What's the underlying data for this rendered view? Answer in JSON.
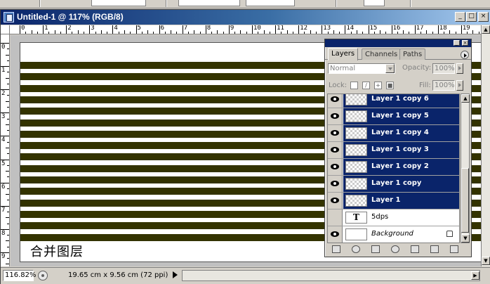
{
  "document": {
    "title": "Untitled-1 @ 117% (RGB/8)",
    "min_glyph": "_",
    "max_glyph": "□",
    "close_glyph": "×",
    "canvas_text": "合并图层",
    "stripe_color": "#333300"
  },
  "rulers": {
    "horizontal": [
      "0",
      "1",
      "2",
      "3",
      "4",
      "5",
      "6",
      "7",
      "8",
      "9",
      "10",
      "11",
      "12",
      "13",
      "14",
      "15",
      "16",
      "17",
      "18",
      "19"
    ],
    "vertical": [
      "0",
      "1",
      "2",
      "3",
      "4",
      "5",
      "6",
      "7",
      "8",
      "9"
    ]
  },
  "status": {
    "zoom": "116.82%",
    "doc_size": "19.65 cm x 9.56 cm (72 ppi)"
  },
  "layers_panel": {
    "tabs": [
      "Layers",
      "Channels",
      "Paths"
    ],
    "active_tab": "Layers",
    "blend_mode": "Normal",
    "opacity_label": "Opacity:",
    "opacity_value": "100%",
    "lock_label": "Lock:",
    "fill_label": "Fill:",
    "fill_value": "100%",
    "layers": [
      {
        "name": "Layer 1 copy 6",
        "selected": true,
        "visible": true,
        "kind": "pixel"
      },
      {
        "name": "Layer 1 copy 5",
        "selected": true,
        "visible": true,
        "kind": "pixel"
      },
      {
        "name": "Layer 1 copy 4",
        "selected": true,
        "visible": true,
        "kind": "pixel"
      },
      {
        "name": "Layer 1 copy 3",
        "selected": true,
        "visible": true,
        "kind": "pixel"
      },
      {
        "name": "Layer 1 copy 2",
        "selected": true,
        "visible": true,
        "kind": "pixel"
      },
      {
        "name": "Layer 1 copy",
        "selected": true,
        "visible": true,
        "kind": "pixel"
      },
      {
        "name": "Layer 1",
        "selected": true,
        "visible": true,
        "kind": "pixel"
      },
      {
        "name": "5dps",
        "selected": false,
        "visible": false,
        "kind": "text"
      },
      {
        "name": "Background",
        "selected": false,
        "visible": true,
        "kind": "background",
        "locked": true
      }
    ],
    "text_thumb_glyph": "T"
  }
}
